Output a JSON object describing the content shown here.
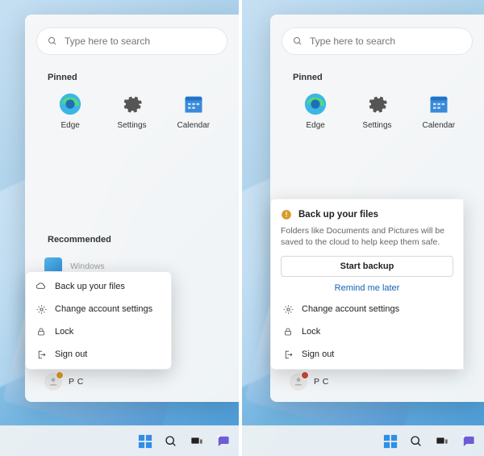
{
  "search": {
    "placeholder": "Type here to search"
  },
  "sections": {
    "pinned": "Pinned",
    "recommended": "Recommended"
  },
  "pinned": [
    {
      "id": "edge",
      "label": "Edge"
    },
    {
      "id": "settings",
      "label": "Settings"
    },
    {
      "id": "calendar",
      "label": "Calendar"
    }
  ],
  "recommended_item": {
    "label": "Windows"
  },
  "context_menu": {
    "backup": "Back up your files",
    "change_account": "Change account settings",
    "lock": "Lock",
    "sign_out": "Sign out"
  },
  "backup_card": {
    "icon": "warning",
    "title": "Back up your files",
    "description": "Folders like Documents and Pictures will be saved to the cloud to help keep them safe.",
    "primary_button": "Start backup",
    "secondary_link": "Remind me later"
  },
  "user": {
    "name": "P C"
  },
  "colors": {
    "accent": "#1564b3",
    "warning": "#d99a2b",
    "alert": "#c94b3a"
  },
  "taskbar_icons": [
    "start",
    "search",
    "task-view",
    "chat"
  ]
}
